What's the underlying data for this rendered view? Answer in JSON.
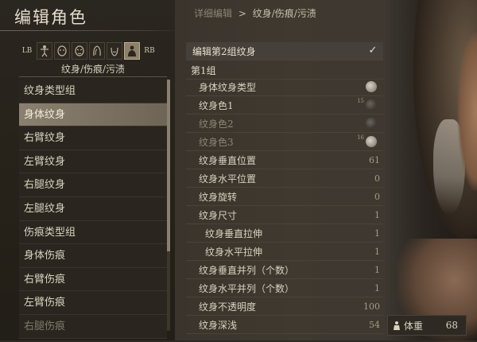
{
  "header": {
    "title": "编辑角色",
    "breadcrumb": [
      "详细编辑",
      "纹身/伤痕/污渍"
    ],
    "breadcrumb_sep": ">"
  },
  "tabs": {
    "left_button": "LB",
    "right_button": "RB",
    "caption": "纹身/伤痕/污渍",
    "icons": [
      "body-icon",
      "face-icon",
      "mask-icon",
      "hair-icon",
      "tattoo-icon"
    ]
  },
  "categories": [
    {
      "label": "纹身类型组"
    },
    {
      "label": "身体纹身"
    },
    {
      "label": "右臂纹身"
    },
    {
      "label": "左臂纹身"
    },
    {
      "label": "右腿纹身"
    },
    {
      "label": "左腿纹身"
    },
    {
      "label": "伤痕类型组"
    },
    {
      "label": "身体伤痕"
    },
    {
      "label": "右臂伤痕"
    },
    {
      "label": "左臂伤痕"
    },
    {
      "label": "右腿伤痕"
    }
  ],
  "selected_category": "身体纹身",
  "panel": {
    "header": "编辑第2组纹身",
    "group": "第1组",
    "rows": [
      {
        "label": "身体纹身类型",
        "value": ""
      },
      {
        "label": "纹身色1",
        "value": "",
        "swatch_num": "15"
      },
      {
        "label": "纹身色2",
        "value": ""
      },
      {
        "label": "纹身色3",
        "value": "",
        "swatch_num": "16"
      },
      {
        "label": "纹身垂直位置",
        "value": "61"
      },
      {
        "label": "纹身水平位置",
        "value": "0"
      },
      {
        "label": "纹身旋转",
        "value": "0"
      },
      {
        "label": "纹身尺寸",
        "value": "1"
      },
      {
        "label": "纹身垂直拉伸",
        "value": "1"
      },
      {
        "label": "纹身水平拉伸",
        "value": "1"
      },
      {
        "label": "纹身垂直并列（个数）",
        "value": "1"
      },
      {
        "label": "纹身水平并列（个数）",
        "value": "1"
      },
      {
        "label": "纹身不透明度",
        "value": "100"
      },
      {
        "label": "纹身深浅",
        "value": "54"
      }
    ]
  },
  "weight": {
    "label": "体重",
    "value": "68"
  },
  "colors": {
    "selected_bg": "#8b8070",
    "panel_bg": "#403930",
    "text": "#d9d2c0"
  }
}
